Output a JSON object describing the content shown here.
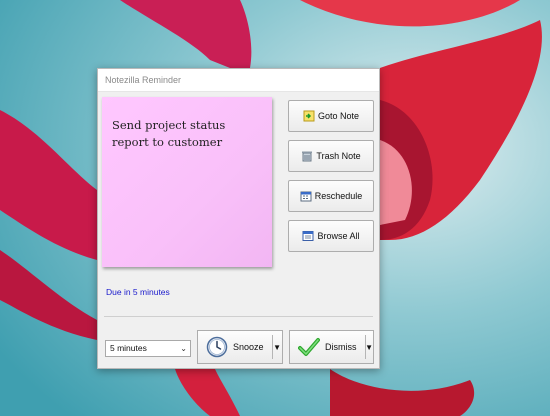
{
  "window": {
    "title": "Notezilla Reminder"
  },
  "note": {
    "text": "Send project status report to customer"
  },
  "actions": {
    "goto": "Goto Note",
    "trash": "Trash Note",
    "reschedule": "Reschedule",
    "browse": "Browse All"
  },
  "due": "Due in 5 minutes",
  "snooze": {
    "selected": "5 minutes",
    "label": "Snooze"
  },
  "dismiss": {
    "label": "Dismiss"
  },
  "colors": {
    "note": "#fbc3fb",
    "due_text": "#1a1acc",
    "sky": "#5fb1c0",
    "flower": "#d0213c"
  }
}
